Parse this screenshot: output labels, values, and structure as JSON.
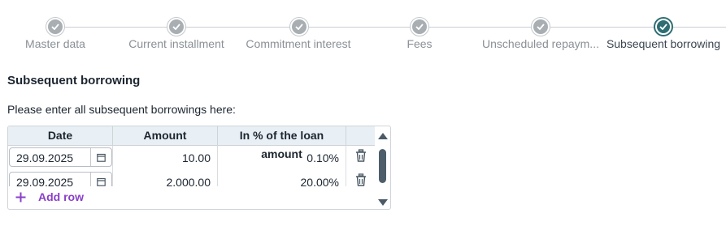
{
  "stepper": {
    "steps": [
      {
        "label": "Master data",
        "state": "done"
      },
      {
        "label": "Current installment",
        "state": "done"
      },
      {
        "label": "Commitment interest",
        "state": "done"
      },
      {
        "label": "Fees",
        "state": "done"
      },
      {
        "label": "Unscheduled repaym...",
        "state": "done"
      },
      {
        "label": "Subsequent borrowing",
        "state": "active"
      }
    ],
    "done_color": "#a9aeb3",
    "active_color": "#2e6e73",
    "icon": "check-icon"
  },
  "section": {
    "title": "Subsequent borrowing",
    "instruction": "Please enter all subsequent borrowings here:"
  },
  "table": {
    "columns": [
      "Date",
      "Amount",
      "In % of the loan amount"
    ],
    "rows": [
      {
        "date": "29.09.2025",
        "amount": "10.00",
        "percent": "0.10%"
      },
      {
        "date": "29.09.2025",
        "amount": "2,000.00",
        "percent": "20.00%"
      }
    ],
    "row_icons": {
      "calendar": "calendar-icon",
      "delete": "trash-icon"
    },
    "header_bg": "#e9f0f5",
    "add_row": {
      "icon": "plus-icon",
      "label": "Add row",
      "color": "#8a3fc8"
    }
  }
}
